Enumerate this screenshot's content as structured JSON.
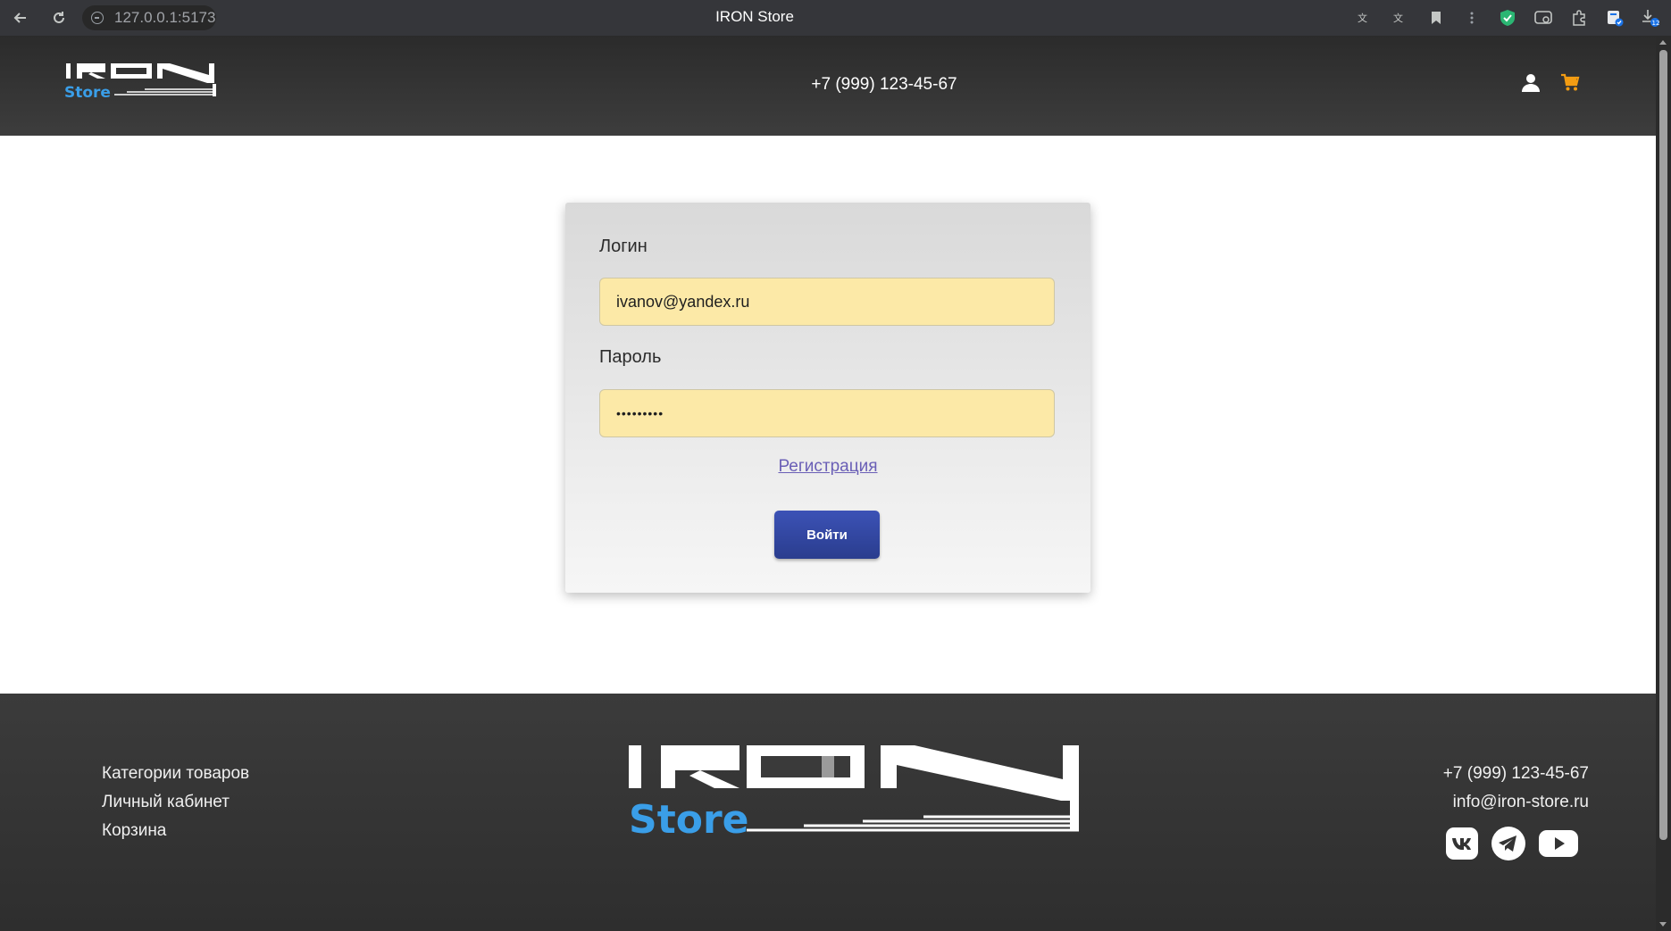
{
  "browser": {
    "url": "127.0.0.1:5173",
    "tab_title": "IRON Store",
    "icons": [
      "back-icon",
      "reload-icon",
      "translate-icon",
      "translate-alt-icon",
      "bookmark-icon",
      "more-icon",
      "shield-extension-icon",
      "screen-capture-icon",
      "extensions-icon",
      "profile-extension-icon",
      "downloads-icon"
    ]
  },
  "header": {
    "logo_word": "IRON",
    "logo_sub": "Store",
    "phone": "+7 (999) 123-45-67",
    "user_icon": "user-icon",
    "cart_icon": "cart-icon",
    "cart_color": "#f39c12"
  },
  "login": {
    "login_label": "Логин",
    "login_value": "ivanov@yandex.ru",
    "password_label": "Пароль",
    "password_value": "•••••••••",
    "register_link": "Регистрация",
    "submit_label": "Войти",
    "input_bg": "#fce9a7",
    "button_color": "#34489f"
  },
  "footer": {
    "links": [
      "Категории товаров",
      "Личный кабинет",
      "Корзина"
    ],
    "logo_word": "IRON",
    "logo_sub": "Store",
    "phone": "+7 (999) 123-45-67",
    "email": "info@iron-store.ru",
    "social": [
      "vk-icon",
      "telegram-icon",
      "youtube-icon"
    ],
    "accent": "#3a9ee8"
  }
}
